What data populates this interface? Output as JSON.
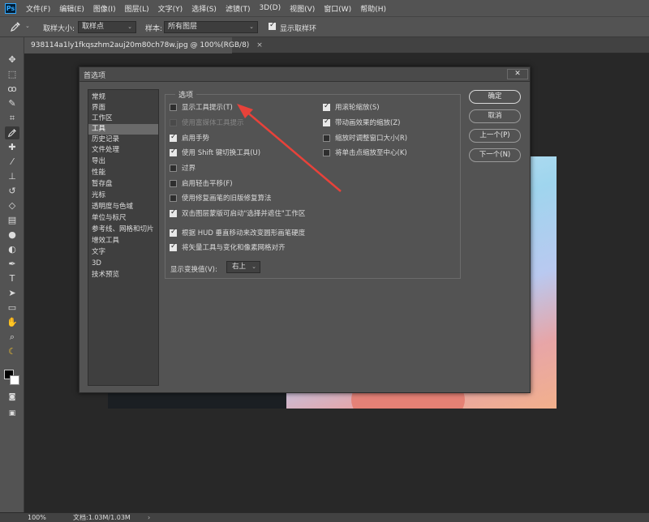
{
  "menubar": {
    "logo": "Ps",
    "items": [
      "文件(F)",
      "编辑(E)",
      "图像(I)",
      "图层(L)",
      "文字(Y)",
      "选择(S)",
      "滤镜(T)",
      "3D(D)",
      "视图(V)",
      "窗口(W)",
      "帮助(H)"
    ]
  },
  "optbar": {
    "sample_size_label": "取样大小:",
    "sample_size_value": "取样点",
    "sample_label": "样本:",
    "sample_value": "所有图层",
    "show_ring_label": "显示取样环",
    "show_ring_checked": true
  },
  "document": {
    "tab_title": "938114a1ly1fkqszhm2auj20m80ch78w.jpg @ 100%(RGB/8)",
    "tab_close": "×"
  },
  "dialog": {
    "title": "首选项",
    "close": "✕",
    "categories": [
      "常规",
      "界面",
      "工作区",
      "工具",
      "历史记录",
      "文件处理",
      "导出",
      "性能",
      "暂存盘",
      "光标",
      "透明度与色域",
      "单位与标尺",
      "参考线、网格和切片",
      "增效工具",
      "文字",
      "3D",
      "技术预览"
    ],
    "selected_category": "工具",
    "options_group_title": "选项",
    "left_options": [
      {
        "label": "显示工具提示(T)",
        "checked": false,
        "disabled": false
      },
      {
        "label": "使用富媒体工具提示",
        "checked": false,
        "disabled": true
      },
      {
        "label": "启用手势",
        "checked": true,
        "disabled": false
      },
      {
        "label": "使用 Shift 键切换工具(U)",
        "checked": true,
        "disabled": false
      },
      {
        "label": "过界",
        "checked": false,
        "disabled": false
      },
      {
        "label": "启用轻击平移(F)",
        "checked": false,
        "disabled": false
      },
      {
        "label": "使用修复画笔的旧版修复算法",
        "checked": false,
        "disabled": false
      },
      {
        "label": "双击图层蒙版可启动\"选择并遮住\"工作区",
        "checked": true,
        "disabled": false
      },
      {
        "label": "根据 HUD 垂直移动来改变圆形画笔硬度",
        "checked": true,
        "disabled": false
      },
      {
        "label": "将矢量工具与变化和像素网格对齐",
        "checked": true,
        "disabled": false
      }
    ],
    "right_options": [
      {
        "label": "用滚轮缩放(S)",
        "checked": true
      },
      {
        "label": "带动画效果的缩放(Z)",
        "checked": true
      },
      {
        "label": "缩放时调整窗口大小(R)",
        "checked": false
      },
      {
        "label": "将单击点缩放至中心(K)",
        "checked": false
      }
    ],
    "hud_label": "显示变换值(V):",
    "hud_value": "右上",
    "buttons": {
      "ok": "确定",
      "cancel": "取消",
      "prev": "上一个(P)",
      "next": "下一个(N)"
    }
  },
  "statusbar": {
    "zoom": "100%",
    "docinfo": "文档:1.03M/1.03M",
    "arrow": "›"
  },
  "colors": {
    "chrome": "#535353",
    "workspace": "#282828",
    "annotation": "#e8423a"
  }
}
